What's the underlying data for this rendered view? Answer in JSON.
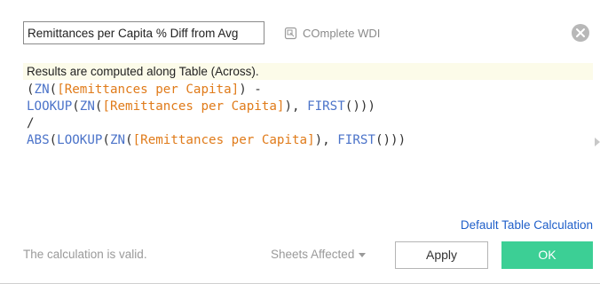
{
  "header": {
    "calc_name": "Remittances per Capita % Diff from Avg",
    "datasource": "COmplete WDI"
  },
  "editor": {
    "info": "Results are computed along Table (Across).",
    "code": {
      "l1": {
        "p1": "(",
        "f1": "ZN",
        "p2": "(",
        "fld1": "[Remittances per Capita]",
        "p3": ") -"
      },
      "l2": {
        "f1": "LOOKUP",
        "p1": "(",
        "f2": "ZN",
        "p2": "(",
        "fld1": "[Remittances per Capita]",
        "p3": "), ",
        "f3": "FIRST",
        "p4": "()))"
      },
      "l3": {
        "p1": "/"
      },
      "l4": {
        "f1": "ABS",
        "p1": "(",
        "f2": "LOOKUP",
        "p2": "(",
        "f3": "ZN",
        "p3": "(",
        "fld1": "[Remittances per Capita]",
        "p4": "), ",
        "f4": "FIRST",
        "p5": "()))"
      }
    },
    "default_link": "Default Table Calculation"
  },
  "footer": {
    "status": "The calculation is valid.",
    "sheets": "Sheets Affected",
    "apply": "Apply",
    "ok": "OK"
  },
  "colors": {
    "function": "#4b73c9",
    "field": "#e07b1a",
    "ok_button": "#3ccf95",
    "link": "#1f5fc9",
    "info_bg": "#fcfbe9"
  },
  "icons": {
    "datasource": "datasource-icon",
    "close": "close-icon",
    "sheets_caret": "caret-down-icon",
    "scroll": "scroll-arrow-icon"
  }
}
